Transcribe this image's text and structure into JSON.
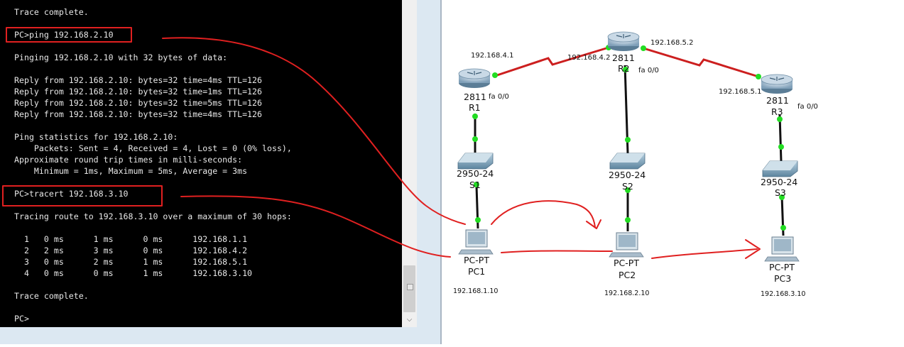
{
  "terminal": {
    "lines": [
      "Trace complete.",
      "",
      "PC>ping 192.168.2.10",
      "",
      "Pinging 192.168.2.10 with 32 bytes of data:",
      "",
      "Reply from 192.168.2.10: bytes=32 time=4ms TTL=126",
      "Reply from 192.168.2.10: bytes=32 time=1ms TTL=126",
      "Reply from 192.168.2.10: bytes=32 time=5ms TTL=126",
      "Reply from 192.168.2.10: bytes=32 time=4ms TTL=126",
      "",
      "Ping statistics for 192.168.2.10:",
      "    Packets: Sent = 4, Received = 4, Lost = 0 (0% loss),",
      "Approximate round trip times in milli-seconds:",
      "    Minimum = 1ms, Maximum = 5ms, Average = 3ms",
      "",
      "PC>tracert 192.168.3.10",
      "",
      "Tracing route to 192.168.3.10 over a maximum of 30 hops:",
      "",
      "  1   0 ms      1 ms      0 ms      192.168.1.1",
      "  2   2 ms      3 ms      0 ms      192.168.4.2",
      "  3   0 ms      2 ms      1 ms      192.168.5.1",
      "  4   0 ms      0 ms      1 ms      192.168.3.10",
      "",
      "Trace complete.",
      "",
      "PC>"
    ]
  },
  "colors": {
    "terminal_bg": "#000000",
    "terminal_text": "#e8e8e8",
    "annotation_red": "#e02020",
    "serial_link": "#cc1f1f",
    "ethernet_link": "#111111",
    "port_dot": "#22dd22"
  },
  "diagram": {
    "routers": [
      {
        "model": "2811",
        "name": "R1",
        "ip_label": "192.168.4.1",
        "port_label": "fa 0/0"
      },
      {
        "model": "2811",
        "name": "R2",
        "ip_label": "192.168.4.2",
        "ip_label_2": "192.168.5.2",
        "port_label": "fa 0/0"
      },
      {
        "model": "2811",
        "name": "R3",
        "ip_label": "192.168.5.1",
        "port_label": "fa 0/0"
      }
    ],
    "switches": [
      {
        "model": "2950-24",
        "name": "S1"
      },
      {
        "model": "2950-24",
        "name": "S2"
      },
      {
        "model": "2950-24",
        "name": "S3"
      }
    ],
    "pcs": [
      {
        "model": "PC-PT",
        "name": "PC1",
        "ip": "192.168.1.10"
      },
      {
        "model": "PC-PT",
        "name": "PC2",
        "ip": "192.168.2.10"
      },
      {
        "model": "PC-PT",
        "name": "PC3",
        "ip": "192.168.3.10"
      }
    ]
  }
}
